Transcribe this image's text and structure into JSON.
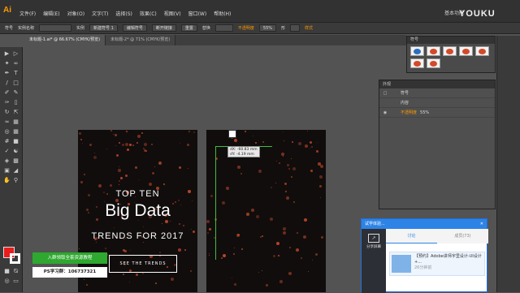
{
  "app": {
    "logo": "Ai",
    "workspace": "基本功能"
  },
  "menu": [
    "文件(F)",
    "编辑(E)",
    "对象(O)",
    "文字(T)",
    "选择(S)",
    "效果(C)",
    "视图(V)",
    "窗口(W)",
    "帮助(H)"
  ],
  "watermark": "YOUKU",
  "controlbar": {
    "label": "符号",
    "instance_name_label": "实例名称",
    "instance_label": "实例",
    "instance_value": "新建符号 1",
    "edit_symbol": "编辑符号",
    "break_link": "断开链接",
    "reset": "重置",
    "replace": "替换",
    "opacity_label": "不透明度",
    "opacity_value": "55%",
    "shape": "形",
    "style_label": "样式"
  },
  "tabs": [
    {
      "label": "未标题-1.ai* @ 66.67% (CMYK/预览)",
      "active": true
    },
    {
      "label": "未标题-2* @ 71% (CMYK/预览)",
      "active": false
    }
  ],
  "symbols_panel": {
    "title": "符号"
  },
  "appearance": {
    "title": "外观",
    "rows": [
      {
        "label": "符号"
      },
      {
        "label": "内容"
      },
      {
        "label": "不透明度",
        "value": "55%"
      }
    ]
  },
  "artboard1": {
    "line1": "TOP TEN",
    "line2": "Big Data",
    "line3": "TRENDS FOR 2017",
    "button": "SEE THE TRENDS"
  },
  "tooltip": {
    "dx": "dX: -60.83 mm",
    "dy": "dY: -4.19 mm"
  },
  "promo": {
    "line1": "入群领取全套资源教程",
    "line2": "PS学习群：106737321"
  },
  "chat": {
    "title": "试学体验...",
    "side_label": "分享屏幕",
    "tab_discuss": "讨论",
    "tab_members": "成员(73)",
    "message": "【预约】Adobe讲师字里设计-UI设计+...",
    "count": "26分钟前"
  }
}
